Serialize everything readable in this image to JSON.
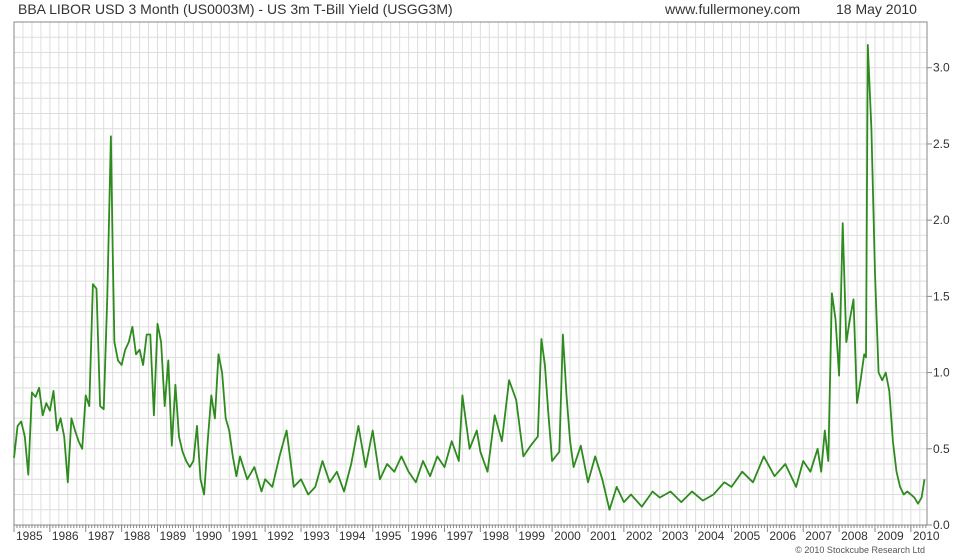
{
  "header": {
    "title": "BBA LIBOR USD 3 Month (US0003M) - US 3m T-Bill Yield (USGG3M)",
    "website": "www.fullermoney.com",
    "date": "18 May 2010"
  },
  "footer": {
    "copyright": "© 2010 Stockcube Research Ltd"
  },
  "colors": {
    "line": "#2e8b1e",
    "grid": "#dedede",
    "axis": "#888888",
    "text": "#333333"
  },
  "chart_data": {
    "type": "line",
    "title": "BBA LIBOR USD 3 Month (US0003M) - US 3m T-Bill Yield (USGG3M)",
    "xlabel": "",
    "ylabel": "",
    "xlim": [
      1985.0,
      2010.45
    ],
    "ylim": [
      0,
      3.3
    ],
    "grid": true,
    "legend": "none",
    "x_tick_labels": [
      "1985",
      "1986",
      "1987",
      "1988",
      "1989",
      "1990",
      "1991",
      "1992",
      "1993",
      "1994",
      "1995",
      "1996",
      "1997",
      "1998",
      "1999",
      "2000",
      "2001",
      "2002",
      "2003",
      "2004",
      "2005",
      "2006",
      "2007",
      "2008",
      "2009",
      "2010"
    ],
    "y_tick_labels": [
      "0.0",
      "0.5",
      "1.0",
      "1.5",
      "2.0",
      "2.5",
      "3.0"
    ],
    "y_tick_values": [
      0,
      0.5,
      1.0,
      1.5,
      2.0,
      2.5,
      3.0
    ],
    "series": [
      {
        "x": [
          1985.0,
          1985.1,
          1985.2,
          1985.3,
          1985.4,
          1985.5,
          1985.6,
          1985.7,
          1985.8,
          1985.9,
          1986.0,
          1986.1,
          1986.2,
          1986.3,
          1986.4,
          1986.5,
          1986.6,
          1986.7,
          1986.8,
          1986.9,
          1987.0,
          1987.1,
          1987.2,
          1987.3,
          1987.4,
          1987.5,
          1987.6,
          1987.7,
          1987.75,
          1987.8,
          1987.9,
          1988.0,
          1988.1,
          1988.2,
          1988.3,
          1988.4,
          1988.5,
          1988.6,
          1988.7,
          1988.8,
          1988.9,
          1989.0,
          1989.1,
          1989.2,
          1989.3,
          1989.4,
          1989.5,
          1989.6,
          1989.7,
          1989.8,
          1989.9,
          1990.0,
          1990.1,
          1990.2,
          1990.3,
          1990.4,
          1990.5,
          1990.6,
          1990.7,
          1990.8,
          1990.9,
          1991.0,
          1991.1,
          1991.2,
          1991.3,
          1991.5,
          1991.7,
          1991.9,
          1992.0,
          1992.2,
          1992.4,
          1992.6,
          1992.8,
          1993.0,
          1993.2,
          1993.4,
          1993.6,
          1993.8,
          1994.0,
          1994.2,
          1994.4,
          1994.6,
          1994.8,
          1995.0,
          1995.2,
          1995.4,
          1995.6,
          1995.8,
          1996.0,
          1996.2,
          1996.4,
          1996.6,
          1996.8,
          1997.0,
          1997.2,
          1997.4,
          1997.5,
          1997.7,
          1997.9,
          1998.0,
          1998.2,
          1998.4,
          1998.6,
          1998.8,
          1999.0,
          1999.2,
          1999.4,
          1999.6,
          1999.7,
          1999.8,
          1999.9,
          2000.0,
          2000.2,
          2000.3,
          2000.4,
          2000.5,
          2000.6,
          2000.8,
          2001.0,
          2001.2,
          2001.4,
          2001.6,
          2001.8,
          2002.0,
          2002.2,
          2002.5,
          2002.8,
          2003.0,
          2003.3,
          2003.6,
          2003.9,
          2004.2,
          2004.5,
          2004.8,
          2005.0,
          2005.3,
          2005.6,
          2005.9,
          2006.2,
          2006.5,
          2006.8,
          2007.0,
          2007.2,
          2007.4,
          2007.5,
          2007.6,
          2007.7,
          2007.8,
          2007.9,
          2008.0,
          2008.1,
          2008.2,
          2008.3,
          2008.4,
          2008.5,
          2008.6,
          2008.7,
          2008.75,
          2008.8,
          2008.9,
          2009.0,
          2009.1,
          2009.2,
          2009.3,
          2009.4,
          2009.5,
          2009.6,
          2009.7,
          2009.8,
          2009.9,
          2010.0,
          2010.1,
          2010.2,
          2010.3,
          2010.38
        ],
        "values": [
          0.44,
          0.65,
          0.68,
          0.58,
          0.33,
          0.87,
          0.84,
          0.9,
          0.72,
          0.8,
          0.75,
          0.88,
          0.62,
          0.7,
          0.58,
          0.28,
          0.7,
          0.62,
          0.55,
          0.5,
          0.85,
          0.78,
          1.58,
          1.55,
          0.78,
          0.76,
          1.5,
          2.55,
          1.8,
          1.2,
          1.08,
          1.05,
          1.15,
          1.2,
          1.3,
          1.12,
          1.15,
          1.05,
          1.25,
          1.25,
          0.72,
          1.32,
          1.2,
          0.78,
          1.08,
          0.52,
          0.92,
          0.58,
          0.48,
          0.42,
          0.38,
          0.42,
          0.65,
          0.3,
          0.2,
          0.55,
          0.85,
          0.7,
          1.12,
          1.0,
          0.7,
          0.62,
          0.45,
          0.32,
          0.45,
          0.3,
          0.38,
          0.22,
          0.3,
          0.25,
          0.45,
          0.62,
          0.25,
          0.3,
          0.2,
          0.25,
          0.42,
          0.28,
          0.35,
          0.22,
          0.4,
          0.65,
          0.38,
          0.62,
          0.3,
          0.4,
          0.35,
          0.45,
          0.35,
          0.28,
          0.42,
          0.32,
          0.45,
          0.38,
          0.55,
          0.42,
          0.85,
          0.5,
          0.62,
          0.48,
          0.35,
          0.72,
          0.55,
          0.95,
          0.82,
          0.45,
          0.52,
          0.58,
          1.22,
          1.05,
          0.72,
          0.42,
          0.48,
          1.25,
          0.85,
          0.55,
          0.38,
          0.52,
          0.28,
          0.45,
          0.3,
          0.1,
          0.25,
          0.15,
          0.2,
          0.12,
          0.22,
          0.18,
          0.22,
          0.15,
          0.22,
          0.16,
          0.2,
          0.28,
          0.25,
          0.35,
          0.28,
          0.45,
          0.32,
          0.4,
          0.25,
          0.42,
          0.35,
          0.5,
          0.35,
          0.62,
          0.42,
          1.52,
          1.35,
          0.98,
          1.98,
          1.2,
          1.35,
          1.48,
          0.8,
          0.95,
          1.12,
          1.1,
          3.15,
          2.6,
          1.65,
          1.0,
          0.95,
          1.0,
          0.88,
          0.55,
          0.35,
          0.25,
          0.2,
          0.22,
          0.2,
          0.18,
          0.14,
          0.18,
          0.3
        ]
      }
    ]
  }
}
